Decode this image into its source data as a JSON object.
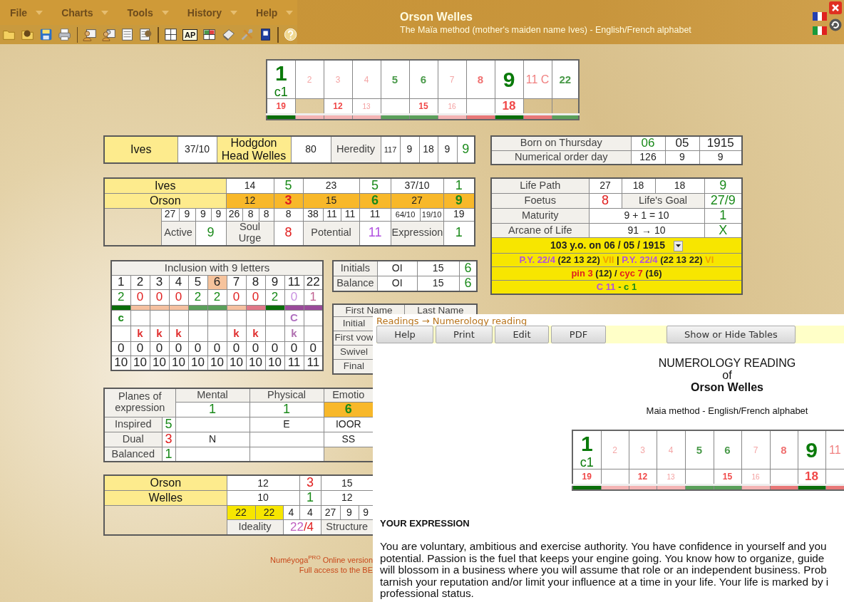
{
  "menu": [
    "File",
    "Charts",
    "Tools",
    "History",
    "Help"
  ],
  "toolbar": [
    {
      "kind": "open"
    },
    {
      "kind": "open-help"
    },
    {
      "kind": "save"
    },
    {
      "kind": "print"
    },
    {
      "kind": "separator"
    },
    {
      "kind": "person-card"
    },
    {
      "kind": "people-card"
    },
    {
      "kind": "number-sheet"
    },
    {
      "kind": "number-sheet-help"
    },
    {
      "kind": "separator"
    },
    {
      "kind": "letter-grid"
    },
    {
      "kind": "text-button",
      "label": "AP"
    },
    {
      "kind": "color-grid"
    },
    {
      "kind": "notepad"
    },
    {
      "kind": "tools"
    },
    {
      "kind": "book"
    },
    {
      "kind": "separator"
    },
    {
      "kind": "help"
    }
  ],
  "title": {
    "name": "Orson Welles",
    "subtitle": "The Maïa method (mother's maiden name Ives) - English/French alphabet"
  },
  "number_chart": {
    "columns": [
      {
        "top": {
          "text": "1",
          "kind": "major",
          "color": "#0a7a0a"
        },
        "sub": "c1",
        "bottom": {
          "text": "19",
          "kind": "strong",
          "color": "#f04848"
        },
        "filled": true,
        "bar": {
          "color": "#0a6e0a"
        }
      },
      {
        "top": {
          "text": "2",
          "kind": "faint",
          "color": "#f4a6a6"
        },
        "filled": false,
        "bar": {
          "color": "#f4b4b4"
        }
      },
      {
        "top": {
          "text": "3",
          "kind": "faint",
          "color": "#f4a6a6"
        },
        "bottom": {
          "text": "12",
          "kind": "strong",
          "color": "#f04848"
        },
        "filled": true,
        "bar": {
          "color": "#f4b4b4"
        }
      },
      {
        "top": {
          "text": "4",
          "kind": "faint",
          "color": "#f4a6a6"
        },
        "bottom": {
          "text": "13",
          "kind": "faint",
          "color": "#f4a0a0"
        },
        "filled": true,
        "bar": {
          "color": "#f4b4b4"
        }
      },
      {
        "top": {
          "text": "5",
          "kind": "strong",
          "color": "#4a9a4a"
        },
        "filled": true,
        "bar": {
          "color": "#5aa05a"
        }
      },
      {
        "top": {
          "text": "6",
          "kind": "strong",
          "color": "#4a9a4a"
        },
        "bottom": {
          "text": "15",
          "kind": "strong",
          "color": "#f04848"
        },
        "filled": true,
        "bar": {
          "color": "#5aa05a"
        }
      },
      {
        "top": {
          "text": "7",
          "kind": "faint",
          "color": "#f4a6a6"
        },
        "bottom": {
          "text": "16",
          "kind": "faint",
          "color": "#f4a0a0"
        },
        "filled": true,
        "bar": {
          "color": "#f4b4b4"
        }
      },
      {
        "top": {
          "text": "8",
          "kind": "strong",
          "color": "#f07070"
        },
        "filled": true,
        "bar": {
          "color": "#e87878"
        }
      },
      {
        "top": {
          "text": "9",
          "kind": "major",
          "color": "#0a7a0a"
        },
        "bottom": {
          "text": "18",
          "kind": "major",
          "color": "#f04848"
        },
        "filled": true,
        "bar": {
          "color": "#0a6e0a"
        }
      },
      {
        "top": {
          "text": "11 C",
          "kind": "plain",
          "color": "#f08080"
        },
        "filled": false,
        "bar": {
          "color": "#e87878"
        }
      },
      {
        "top": {
          "text": "22",
          "kind": "strong",
          "color": "#4a9a4a"
        },
        "filled": false,
        "bar": {
          "color": "#5aa05a"
        }
      }
    ]
  },
  "tables": [
    {
      "rows": [
        {
          "cells": [
            {
              "text": "Ives",
              "kind": "name"
            },
            {
              "text": "37/10",
              "kind": "value"
            },
            {
              "text": "Hodgdon Head Welles",
              "kind": "name"
            },
            {
              "text": "80",
              "kind": "value"
            },
            {
              "text": "Heredity",
              "kind": "label"
            },
            {
              "text": "117",
              "kind": "small"
            },
            {
              "text": "9",
              "kind": "value"
            },
            {
              "text": "18",
              "kind": "value"
            },
            {
              "text": "9",
              "kind": "value"
            },
            {
              "text": "9",
              "kind": "value",
              "color": "#1a8a1a"
            }
          ]
        }
      ]
    },
    {
      "rows": [
        {
          "cells": [
            {
              "text": "Ives",
              "kind": "name",
              "colspan": 5
            },
            {
              "text": "14",
              "kind": "value",
              "colspan": 3
            },
            {
              "text": "5",
              "kind": "value",
              "color": "#1a8a1a"
            },
            {
              "text": "23",
              "kind": "value",
              "colspan": 3
            },
            {
              "text": "5",
              "kind": "value",
              "color": "#1a8a1a"
            },
            {
              "text": "37/10",
              "kind": "value",
              "colspan": 2
            },
            {
              "text": "1",
              "kind": "value",
              "color": "#1a8a1a"
            }
          ]
        },
        {
          "cells": [
            {
              "text": "Orson",
              "kind": "name",
              "colspan": 5
            },
            {
              "text": "12",
              "kind": "hot",
              "colspan": 3
            },
            {
              "text": "3",
              "kind": "hot",
              "color": "#e02020"
            },
            {
              "text": "15",
              "kind": "hot",
              "colspan": 3
            },
            {
              "text": "6",
              "kind": "hot",
              "color": "#1a8a1a"
            },
            {
              "text": "27",
              "kind": "hot",
              "colspan": 2
            },
            {
              "text": "9",
              "kind": "hot",
              "color": "#1a8a1a"
            }
          ]
        },
        {
          "cells": [
            {
              "kind": "blank",
              "rowspan": 2
            },
            {
              "text": "27",
              "kind": "value"
            },
            {
              "text": "9",
              "kind": "value"
            },
            {
              "text": "9",
              "kind": "value"
            },
            {
              "text": "9",
              "kind": "value"
            },
            {
              "text": "26",
              "kind": "value"
            },
            {
              "text": "8",
              "kind": "value"
            },
            {
              "text": "8",
              "kind": "value"
            },
            {
              "text": "8",
              "kind": "value"
            },
            {
              "text": "38",
              "kind": "value"
            },
            {
              "text": "11",
              "kind": "value"
            },
            {
              "text": "11",
              "kind": "value"
            },
            {
              "text": "11",
              "kind": "value"
            },
            {
              "text": "64/10",
              "kind": "small"
            },
            {
              "text": "19/10",
              "kind": "small"
            },
            {
              "text": "19",
              "kind": "value"
            }
          ]
        },
        {
          "cells": [
            {
              "text": "Active",
              "kind": "label",
              "colspan": 2
            },
            {
              "text": "9",
              "kind": "value",
              "color": "#1a8a1a",
              "colspan": 2
            },
            {
              "text": "Soul Urge",
              "kind": "label",
              "colspan": 3
            },
            {
              "text": "8",
              "kind": "value",
              "color": "#e02020"
            },
            {
              "text": "Potential",
              "kind": "label",
              "colspan": 3
            },
            {
              "text": "11",
              "kind": "value",
              "color": "#b050e0"
            },
            {
              "text": "Expression",
              "kind": "label",
              "colspan": 2
            },
            {
              "text": "1",
              "kind": "value",
              "color": "#1a8a1a"
            }
          ]
        }
      ]
    },
    {
      "rows": [
        {
          "cells": [
            {
              "text": "Inclusion with 9 letters",
              "kind": "label",
              "colspan": 11
            }
          ]
        },
        {
          "cells": [
            {
              "text": "1",
              "kind": "value"
            },
            {
              "text": "2",
              "kind": "value"
            },
            {
              "text": "3",
              "kind": "value"
            },
            {
              "text": "4",
              "kind": "value"
            },
            {
              "text": "5",
              "kind": "value"
            },
            {
              "text": "6",
              "kind": "peach"
            },
            {
              "text": "7",
              "kind": "value"
            },
            {
              "text": "8",
              "kind": "value"
            },
            {
              "text": "9",
              "kind": "value"
            },
            {
              "text": "11",
              "kind": "value"
            },
            {
              "text": "22",
              "kind": "value"
            }
          ]
        },
        {
          "cells": [
            {
              "text": "2",
              "kind": "value",
              "color": "#1a8a1a"
            },
            {
              "text": "0",
              "kind": "value",
              "color": "#e02020"
            },
            {
              "text": "0",
              "kind": "value",
              "color": "#e02020"
            },
            {
              "text": "0",
              "kind": "value",
              "color": "#e02020"
            },
            {
              "text": "2",
              "kind": "value",
              "color": "#1a8a1a"
            },
            {
              "text": "2",
              "kind": "value",
              "color": "#1a8a1a"
            },
            {
              "text": "0",
              "kind": "value",
              "color": "#e02020"
            },
            {
              "text": "0",
              "kind": "value",
              "color": "#e02020"
            },
            {
              "text": "2",
              "kind": "value",
              "color": "#1a8a1a"
            },
            {
              "text": "0",
              "kind": "value",
              "color": "#c890e0"
            },
            {
              "text": "1",
              "kind": "value",
              "color": "#c06090"
            }
          ]
        },
        {
          "cells": [
            {
              "kind": "bar",
              "color": "#0a6e0a"
            },
            {
              "kind": "bar",
              "color": "#f5c0a0"
            },
            {
              "kind": "bar",
              "color": "#f5c0a0"
            },
            {
              "kind": "bar",
              "color": "#f5c0a0"
            },
            {
              "kind": "bar",
              "color": "#5aa05a"
            },
            {
              "kind": "bar",
              "color": "#5aa05a"
            },
            {
              "kind": "bar",
              "color": "#f5c0a0"
            },
            {
              "kind": "bar",
              "color": "#e07888"
            },
            {
              "kind": "bar",
              "color": "#0a6e0a"
            },
            {
              "kind": "bar",
              "color": "#9a4a9a"
            },
            {
              "kind": "bar",
              "color": "#9a4a9a"
            }
          ]
        },
        {
          "cells": [
            {
              "text": "c",
              "kind": "letter",
              "color": "#1a8a1a"
            },
            {
              "kind": "empty"
            },
            {
              "kind": "empty"
            },
            {
              "kind": "empty"
            },
            {
              "kind": "empty"
            },
            {
              "kind": "empty"
            },
            {
              "kind": "empty"
            },
            {
              "kind": "empty"
            },
            {
              "kind": "empty"
            },
            {
              "text": "C",
              "kind": "letter",
              "color": "#b070c0"
            },
            {
              "kind": "empty"
            }
          ]
        },
        {
          "cells": [
            {
              "kind": "empty"
            },
            {
              "text": "k",
              "kind": "letter",
              "color": "#e03030"
            },
            {
              "text": "k",
              "kind": "letter",
              "color": "#e03030"
            },
            {
              "text": "k",
              "kind": "letter",
              "color": "#e03030"
            },
            {
              "kind": "empty"
            },
            {
              "kind": "empty"
            },
            {
              "text": "k",
              "kind": "letter",
              "color": "#e03030"
            },
            {
              "text": "k",
              "kind": "letter",
              "color": "#e03030"
            },
            {
              "kind": "empty"
            },
            {
              "text": "k",
              "kind": "letter",
              "color": "#b070b0"
            },
            {
              "kind": "empty"
            }
          ]
        },
        {
          "cells": [
            {
              "text": "0",
              "kind": "value"
            },
            {
              "text": "0",
              "kind": "value"
            },
            {
              "text": "0",
              "kind": "value"
            },
            {
              "text": "0",
              "kind": "value"
            },
            {
              "text": "0",
              "kind": "value"
            },
            {
              "text": "0",
              "kind": "value"
            },
            {
              "text": "0",
              "kind": "value"
            },
            {
              "text": "0",
              "kind": "value"
            },
            {
              "text": "0",
              "kind": "value"
            },
            {
              "text": "0",
              "kind": "value"
            },
            {
              "text": "0",
              "kind": "value"
            }
          ]
        },
        {
          "cells": [
            {
              "text": "10",
              "kind": "value"
            },
            {
              "text": "10",
              "kind": "value"
            },
            {
              "text": "10",
              "kind": "value"
            },
            {
              "text": "10",
              "kind": "value"
            },
            {
              "text": "10",
              "kind": "value"
            },
            {
              "text": "10",
              "kind": "value"
            },
            {
              "text": "10",
              "kind": "value"
            },
            {
              "text": "10",
              "kind": "value"
            },
            {
              "text": "10",
              "kind": "value"
            },
            {
              "text": "11",
              "kind": "value"
            },
            {
              "text": "11",
              "kind": "value"
            }
          ]
        }
      ]
    },
    {
      "rows": [
        {
          "cells": [
            {
              "text": "Initials",
              "kind": "label"
            },
            {
              "text": "OI",
              "kind": "value"
            },
            {
              "text": "15",
              "kind": "value"
            },
            {
              "text": "6",
              "kind": "value",
              "color": "#1a8a1a"
            }
          ]
        },
        {
          "cells": [
            {
              "text": "Balance",
              "kind": "label"
            },
            {
              "text": "OI",
              "kind": "value"
            },
            {
              "text": "15",
              "kind": "value"
            },
            {
              "text": "6",
              "kind": "value",
              "color": "#1a8a1a"
            }
          ]
        }
      ]
    },
    {
      "rows": [
        {
          "cells": [
            {
              "text": "First Name",
              "kind": "label",
              "colspan": 2
            },
            {
              "text": "Last Name",
              "kind": "label"
            }
          ]
        },
        {
          "cells": [
            {
              "text": "Initial",
              "kind": "label"
            }
          ]
        },
        {
          "cells": [
            {
              "text": "First vow",
              "kind": "label"
            }
          ]
        },
        {
          "cells": [
            {
              "text": "Swivel",
              "kind": "label"
            }
          ]
        },
        {
          "cells": [
            {
              "text": "Final",
              "kind": "label"
            }
          ]
        }
      ]
    },
    {
      "rows": [
        {
          "cells": [
            {
              "text": "Planes of expression",
              "kind": "label",
              "colspan": 2,
              "rowspan": 2
            },
            {
              "text": "Mental",
              "kind": "label"
            },
            {
              "text": "Physical",
              "kind": "label"
            },
            {
              "text": "Emotio",
              "kind": "label"
            }
          ]
        },
        {
          "cells": [
            {
              "text": "1",
              "kind": "value",
              "color": "#1a8a1a"
            },
            {
              "text": "1",
              "kind": "value",
              "color": "#1a8a1a"
            },
            {
              "text": "6",
              "kind": "hot",
              "color": "#1a8a1a"
            }
          ]
        },
        {
          "cells": [
            {
              "text": "Inspired",
              "kind": "label"
            },
            {
              "text": "5",
              "kind": "value",
              "color": "#1a8a1a"
            },
            {
              "kind": "empty"
            },
            {
              "text": "E",
              "kind": "value"
            },
            {
              "text": "IOOR",
              "kind": "value"
            }
          ]
        },
        {
          "cells": [
            {
              "text": "Dual",
              "kind": "label"
            },
            {
              "text": "3",
              "kind": "value",
              "color": "#e02020"
            },
            {
              "text": "N",
              "kind": "value"
            },
            {
              "kind": "empty"
            },
            {
              "text": "SS",
              "kind": "value"
            }
          ]
        },
        {
          "cells": [
            {
              "text": "Balanced",
              "kind": "label"
            },
            {
              "text": "1",
              "kind": "value",
              "color": "#1a8a1a"
            },
            {
              "kind": "empty"
            },
            {
              "kind": "empty"
            },
            {
              "kind": "blank"
            }
          ]
        }
      ]
    },
    {
      "rows": [
        {
          "cells": [
            {
              "text": "Orson",
              "kind": "name"
            },
            {
              "text": "12",
              "kind": "value",
              "colspan": 3
            },
            {
              "text": "3",
              "kind": "value",
              "color": "#e02020"
            },
            {
              "text": "15",
              "kind": "value",
              "colspan": 3
            }
          ]
        },
        {
          "cells": [
            {
              "text": "Welles",
              "kind": "name"
            },
            {
              "text": "10",
              "kind": "value",
              "colspan": 3
            },
            {
              "text": "1",
              "kind": "value",
              "color": "#1a8a1a"
            },
            {
              "text": "12",
              "kind": "value",
              "colspan": 3
            }
          ]
        },
        {
          "cells": [
            {
              "kind": "blank",
              "rowspan": 2
            },
            {
              "text": "22",
              "kind": "gold"
            },
            {
              "text": "22",
              "kind": "gold"
            },
            {
              "text": "4",
              "kind": "value"
            },
            {
              "text": "4",
              "kind": "value"
            },
            {
              "text": "27",
              "kind": "value"
            },
            {
              "text": "9",
              "kind": "value"
            },
            {
              "text": "9",
              "kind": "value"
            }
          ]
        },
        {
          "cells": [
            {
              "text": "Ideality",
              "kind": "label",
              "colspan": 2
            },
            {
              "kind": "big",
              "colspan": 2,
              "parts": [
                {
                  "text": "22",
                  "color": "#c060c0"
                },
                {
                  "text": "/4",
                  "color": "#e02020"
                }
              ]
            },
            {
              "text": "Structure",
              "kind": "label",
              "colspan": 3
            }
          ]
        }
      ]
    },
    {
      "rows": [
        {
          "cells": [
            {
              "text": "Born on Thursday",
              "kind": "label"
            },
            {
              "text": "06",
              "kind": "big",
              "color": "#1a8a1a"
            },
            {
              "text": "05",
              "kind": "big"
            },
            {
              "text": "1915",
              "kind": "big"
            }
          ]
        },
        {
          "cells": [
            {
              "text": "Numerical order day",
              "kind": "label"
            },
            {
              "text": "126",
              "kind": "value"
            },
            {
              "text": "9",
              "kind": "value"
            },
            {
              "text": "9",
              "kind": "value"
            }
          ]
        }
      ]
    },
    {
      "rows": [
        {
          "cells": [
            {
              "text": "Life Path",
              "kind": "label"
            },
            {
              "text": "27",
              "kind": "value"
            },
            {
              "text": "18",
              "kind": "value"
            },
            {
              "text": "18",
              "kind": "value"
            },
            {
              "text": "9",
              "kind": "value",
              "color": "#1a8a1a"
            }
          ]
        },
        {
          "cells": [
            {
              "text": "Foetus",
              "kind": "label"
            },
            {
              "text": "8",
              "kind": "value",
              "color": "#e02020"
            },
            {
              "text": "Life's Goal",
              "kind": "label",
              "colspan": 2
            },
            {
              "text": "27/9",
              "kind": "value",
              "color": "#1a8a1a"
            }
          ]
        },
        {
          "cells": [
            {
              "text": "Maturity",
              "kind": "label"
            },
            {
              "text": "9 + 1 = 10",
              "kind": "value",
              "colspan": 3
            },
            {
              "text": "1",
              "kind": "value",
              "color": "#1a8a1a"
            }
          ]
        },
        {
          "cells": [
            {
              "text": "Arcane of Life",
              "kind": "label"
            },
            {
              "text": "91 → 10",
              "kind": "value",
              "colspan": 3
            },
            {
              "text": "X",
              "kind": "value",
              "color": "#1a8a1a"
            }
          ]
        },
        {
          "cells": [
            {
              "text": "103 y.o. on 06 / 05 / 1915",
              "kind": "gold",
              "dropdown": true,
              "colspan": 5
            }
          ]
        },
        {
          "cells": [
            {
              "kind": "gold",
              "colspan": 5,
              "parts": [
                {
                  "text": "P.Y. 22/4",
                  "color": "#b050e0"
                },
                {
                  "text": " (22 13 22) ",
                  "color": "#222222"
                },
                {
                  "text": "VII",
                  "color": "#f0a000"
                },
                {
                  "text": " | ",
                  "color": "#222222"
                },
                {
                  "text": "P.Y. 22/4",
                  "color": "#b050e0"
                },
                {
                  "text": " (22 13 22) ",
                  "color": "#222222"
                },
                {
                  "text": "VI",
                  "color": "#f0a000"
                }
              ]
            }
          ]
        },
        {
          "cells": [
            {
              "kind": "gold",
              "colspan": 5,
              "parts": [
                {
                  "text": "pin 3",
                  "color": "#e02020"
                },
                {
                  "text": " (12) / ",
                  "color": "#222222"
                },
                {
                  "text": "cyc 7",
                  "color": "#e02020"
                },
                {
                  "text": " (16)",
                  "color": "#222222"
                }
              ]
            }
          ]
        },
        {
          "cells": [
            {
              "kind": "gold",
              "colspan": 5,
              "parts": [
                {
                  "text": "C 11",
                  "color": "#b050e0"
                },
                {
                  "text": " - c 1",
                  "color": "#1a8a1a"
                }
              ]
            }
          ]
        }
      ]
    }
  ],
  "footer": {
    "version": "Numéyoga$^{PRO}$ Online version",
    "access": "Full access to the BE"
  },
  "reading_panel": {
    "breadcrumb": "Readings → Numerology reading",
    "buttons": [
      "Help",
      "Print",
      "Edit",
      "PDF",
      "Show or Hide Tables"
    ],
    "heading": "NUMEROLOGY READING",
    "of": "of",
    "name": "Orson Welles",
    "method": "Maia method - English/French alphabet",
    "chart": {
      "columns": [
        {
          "top": {
            "text": "1",
            "kind": "major",
            "color": "#0a7a0a"
          },
          "sub": "c1",
          "bottom": {
            "text": "19",
            "kind": "strong",
            "color": "#f04848"
          },
          "bar": {
            "color": "#0a6e0a"
          }
        },
        {
          "top": {
            "text": "2",
            "kind": "faint",
            "color": "#f4a6a6"
          },
          "bar": {
            "color": "#f4b4b4"
          }
        },
        {
          "top": {
            "text": "3",
            "kind": "faint",
            "color": "#f4a6a6"
          },
          "bottom": {
            "text": "12",
            "kind": "strong",
            "color": "#f04848"
          },
          "bar": {
            "color": "#f4b4b4"
          }
        },
        {
          "top": {
            "text": "4",
            "kind": "faint",
            "color": "#f4a6a6"
          },
          "bottom": {
            "text": "13",
            "kind": "faint",
            "color": "#f4a0a0"
          },
          "bar": {
            "color": "#f4b4b4"
          }
        },
        {
          "top": {
            "text": "5",
            "kind": "strong",
            "color": "#4a9a4a"
          },
          "bar": {
            "color": "#5aa05a"
          }
        },
        {
          "top": {
            "text": "6",
            "kind": "strong",
            "color": "#4a9a4a"
          },
          "bottom": {
            "text": "15",
            "kind": "strong",
            "color": "#f04848"
          },
          "bar": {
            "color": "#5aa05a"
          }
        },
        {
          "top": {
            "text": "7",
            "kind": "faint",
            "color": "#f4a6a6"
          },
          "bottom": {
            "text": "16",
            "kind": "faint",
            "color": "#f4a0a0"
          },
          "bar": {
            "color": "#f4b4b4"
          }
        },
        {
          "top": {
            "text": "8",
            "kind": "strong",
            "color": "#f07070"
          },
          "bar": {
            "color": "#e87878"
          }
        },
        {
          "top": {
            "text": "9",
            "kind": "major",
            "color": "#0a7a0a"
          },
          "bottom": {
            "text": "18",
            "kind": "major",
            "color": "#f04848"
          },
          "bar": {
            "color": "#0a6e0a"
          }
        },
        {
          "top": {
            "text": "11",
            "kind": "plain",
            "color": "#f08080"
          },
          "bar": {
            "color": "#e87878"
          }
        }
      ]
    },
    "section_title": "YOUR EXPRESSION",
    "text_lines": [
      "You are voluntary, ambitious and exercise authority. You have confidence in yourself and you",
      "potential. Passion is the fuel that keeps your engine going. You know how to organize, guide",
      "will blossom in a business where you will assume that role or an independent business. Prob",
      "tarnish your reputation and/or limit your influence at a time in your life. Your life is marked by i",
      "professional status."
    ]
  }
}
